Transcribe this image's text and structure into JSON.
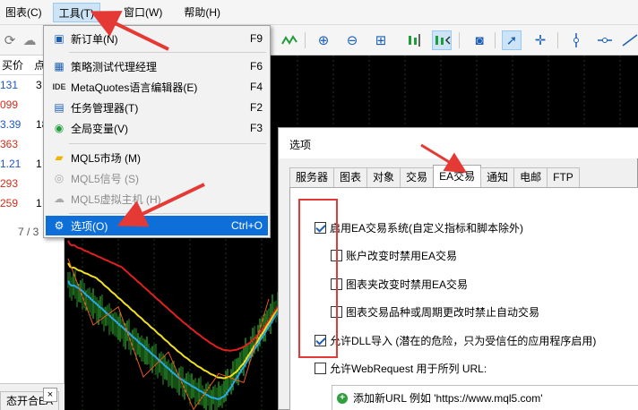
{
  "menubar": {
    "items": [
      {
        "label": "图表(C)"
      },
      {
        "label": "工具(T)"
      },
      {
        "label": "窗口(W)"
      },
      {
        "label": "帮助(H)"
      }
    ]
  },
  "left_panel": {
    "header": [
      "买价",
      "点"
    ],
    "rows": [
      {
        "price": "131",
        "qty": "3",
        "color": "#1a56c8"
      },
      {
        "price": "099",
        "qty": "",
        "color": "#d62c1a"
      },
      {
        "price": "3.39",
        "qty": "18",
        "color": "#1a56c8"
      },
      {
        "price": "363",
        "qty": "",
        "color": "#d62c1a"
      },
      {
        "price": "1.21",
        "qty": "1",
        "color": "#1a56c8"
      },
      {
        "price": "293",
        "qty": "",
        "color": "#d62c1a"
      },
      {
        "price": "259",
        "qty": "1",
        "color": "#d62c1a"
      }
    ],
    "page_indicator": "7 / 3",
    "bottom_tab": "态开合EA",
    "close_label": "×"
  },
  "tools_menu": {
    "items": [
      {
        "label": "新订单(N)",
        "shortcut": "F9",
        "icon": "new-order-icon",
        "glyph": "▣"
      },
      {
        "label": "策略测试代理经理",
        "shortcut": "F6",
        "icon": "chip-icon",
        "glyph": "▦"
      },
      {
        "label": "MetaQuotes语言编辑器(E)",
        "shortcut": "F4",
        "icon": "ide-icon",
        "glyph": "IDE"
      },
      {
        "label": "任务管理器(T)",
        "shortcut": "F2",
        "icon": "task-manager-icon",
        "glyph": "▤"
      },
      {
        "label": "全局变量(V)",
        "shortcut": "F3",
        "icon": "global-variables-icon",
        "glyph": "◉"
      },
      {
        "label": "MQL5市场 (M)",
        "shortcut": "",
        "icon": "market-bag-icon",
        "glyph": "▰"
      },
      {
        "label": "MQL5信号 (S)",
        "shortcut": "",
        "icon": "signals-icon",
        "glyph": "◎"
      },
      {
        "label": "MQL5虚拟主机 (H)",
        "shortcut": "",
        "icon": "cloud-icon",
        "glyph": "☁"
      },
      {
        "label": "选项(O)",
        "shortcut": "Ctrl+O",
        "icon": "gear-icon",
        "glyph": "⚙"
      }
    ]
  },
  "options_dialog": {
    "title": "选项",
    "tabs": [
      "服务器",
      "图表",
      "对象",
      "交易",
      "EA交易",
      "通知",
      "电邮",
      "FTP"
    ],
    "active_tab": "EA交易",
    "checkboxes": [
      {
        "label": "启用EA交易系统(自定义指标和脚本除外)",
        "checked": true
      },
      {
        "label": "账户改变时禁用EA交易",
        "checked": false
      },
      {
        "label": "图表夹改变时禁用EA交易",
        "checked": false
      },
      {
        "label": "图表交易品种或周期更改时禁止自动交易",
        "checked": false
      },
      {
        "label": "允许DLL导入 (潜在的危险，只为受信任的应用程序启用)",
        "checked": true
      },
      {
        "label": "允许WebRequest 用于所列 URL:",
        "checked": false
      }
    ],
    "url_list": {
      "add_label": "添加新URL 例如 'https://www.mql5.com'"
    }
  },
  "colors": {
    "highlight": "#0f6fd8",
    "annotation_red": "#e53935",
    "chart_bg": "#000000",
    "price_up": "#1a56c8",
    "price_down": "#d62c1a"
  }
}
